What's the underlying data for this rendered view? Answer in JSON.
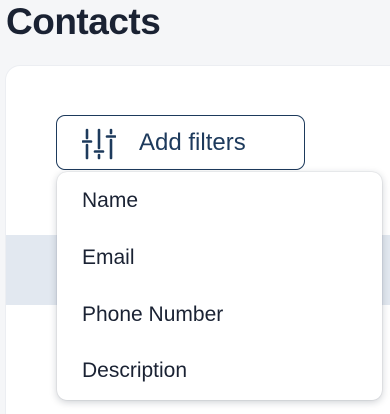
{
  "page": {
    "title": "Contacts"
  },
  "filters": {
    "button_label": "Add filters",
    "icon": "sliders-icon",
    "menu_items": [
      {
        "label": "Name"
      },
      {
        "label": "Email"
      },
      {
        "label": "Phone Number"
      },
      {
        "label": "Description"
      }
    ]
  },
  "colors": {
    "accent": "#1d3a5c",
    "title_text": "#1a2233",
    "table_header": "#e2e8f0"
  }
}
